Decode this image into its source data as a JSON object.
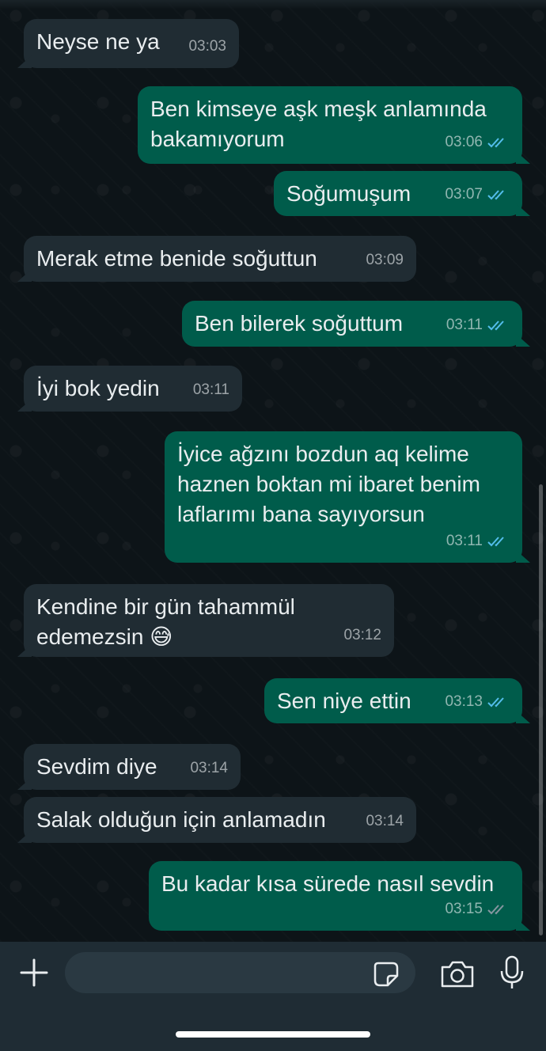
{
  "messages": [
    {
      "dir": "in",
      "text": "Neyse ne ya",
      "time": "03:03"
    },
    {
      "dir": "out",
      "text": "Ben kimseye aşk meşk anlamında\nbakamıyorum",
      "time": "03:06",
      "status": "read"
    },
    {
      "dir": "out",
      "text": "Soğumuşum",
      "time": "03:07",
      "status": "read"
    },
    {
      "dir": "in",
      "text": "Merak etme benide soğuttun",
      "time": "03:09"
    },
    {
      "dir": "out",
      "text": "Ben bilerek soğuttum",
      "time": "03:11",
      "status": "read"
    },
    {
      "dir": "in",
      "text": "İyi bok yedin",
      "time": "03:11"
    },
    {
      "dir": "out",
      "text": "İyice ağzını bozdun aq kelime\nhaznen boktan mi ibaret benim\nlaflarımı bana sayıyorsun",
      "time": "03:11",
      "status": "read"
    },
    {
      "dir": "in",
      "text": "Kendine bir gün tahammül\nedemezsin 😅",
      "time": "03:12"
    },
    {
      "dir": "out",
      "text": "Sen niye ettin",
      "time": "03:13",
      "status": "read"
    },
    {
      "dir": "in",
      "text": "Sevdim diye",
      "time": "03:14"
    },
    {
      "dir": "in",
      "text": "Salak olduğun için anlamadın",
      "time": "03:14"
    },
    {
      "dir": "out",
      "text": "Bu kadar kısa sürede nasıl sevdin",
      "time": "03:15",
      "status": "delivered"
    }
  ],
  "composer": {
    "value": "",
    "placeholder": ""
  },
  "icons": {
    "attach": "plus-icon",
    "sticker": "sticker-icon",
    "camera": "camera-icon",
    "mic": "microphone-icon"
  },
  "colors": {
    "incoming_bubble": "#202c33",
    "outgoing_bubble": "#005c4b",
    "read_ticks": "#53bdeb",
    "delivered_ticks": "#8696a0",
    "background": "#0b141a"
  }
}
